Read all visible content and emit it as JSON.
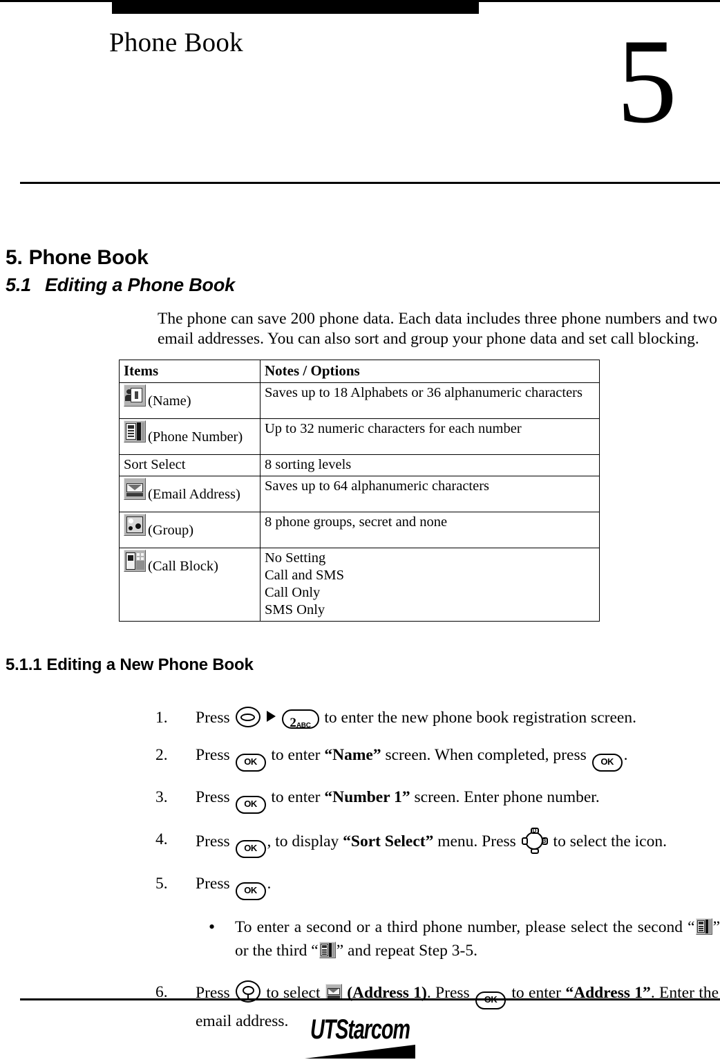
{
  "header": {
    "running_title": "Phone Book",
    "chapter_number": "5"
  },
  "headings": {
    "h1_number": "5.",
    "h1_title": "Phone Book",
    "h2_number": "5.1",
    "h2_title": "Editing a Phone Book",
    "h3_number": "5.1.1",
    "h3_title": "Editing a New Phone Book"
  },
  "intro_paragraph": "The phone can save 200 phone data. Each data includes three phone numbers and two email addresses. You can also sort and group your phone data and set call blocking.",
  "table": {
    "columns": [
      "Items",
      "Notes / Options"
    ],
    "rows": [
      {
        "icon": "name-icon",
        "label": "(Name)",
        "options": [
          "Saves up to 18 Alphabets or 36 alphanumeric characters"
        ]
      },
      {
        "icon": "phone-number-icon",
        "label": "(Phone Number)",
        "options": [
          "Up to 32 numeric characters for each number"
        ]
      },
      {
        "icon": "",
        "label": "Sort Select",
        "options": [
          "8 sorting levels"
        ]
      },
      {
        "icon": "email-address-icon",
        "label": "(Email Address)",
        "options": [
          "Saves up to 64 alphanumeric characters"
        ]
      },
      {
        "icon": "group-icon",
        "label": "(Group)",
        "options": [
          "8 phone groups, secret and none"
        ]
      },
      {
        "icon": "call-block-icon",
        "label": "(Call Block)",
        "options": [
          "No Setting",
          "Call and SMS",
          "Call Only",
          "SMS Only"
        ]
      }
    ]
  },
  "steps": [
    {
      "number": "1.",
      "parts": [
        {
          "t": "text",
          "v": "Press "
        },
        {
          "t": "key",
          "v": "soft-key"
        },
        {
          "t": "arrow",
          "v": "right-arrow-icon"
        },
        {
          "t": "key",
          "v": "2abc-key"
        },
        {
          "t": "text",
          "v": " to enter the new phone book registration screen."
        }
      ]
    },
    {
      "number": "2.",
      "parts": [
        {
          "t": "text",
          "v": "Press "
        },
        {
          "t": "key",
          "v": "ok-key"
        },
        {
          "t": "text",
          "v": " to enter "
        },
        {
          "t": "bold",
          "v": "“Name”"
        },
        {
          "t": "text",
          "v": " screen. When completed, press "
        },
        {
          "t": "key",
          "v": "ok-key"
        },
        {
          "t": "text",
          "v": "."
        }
      ]
    },
    {
      "number": "3.",
      "parts": [
        {
          "t": "text",
          "v": "Press "
        },
        {
          "t": "key",
          "v": "ok-key"
        },
        {
          "t": "text",
          "v": " to enter "
        },
        {
          "t": "bold",
          "v": "“Number 1”"
        },
        {
          "t": "text",
          "v": " screen. Enter phone number."
        }
      ]
    },
    {
      "number": "4.",
      "parts": [
        {
          "t": "text",
          "v": "Press "
        },
        {
          "t": "key",
          "v": "ok-key"
        },
        {
          "t": "text",
          "v": ", to display "
        },
        {
          "t": "bold",
          "v": "“Sort Select”"
        },
        {
          "t": "text",
          "v": " menu. Press "
        },
        {
          "t": "key",
          "v": "nav-key"
        },
        {
          "t": "text",
          "v": " to select the icon."
        }
      ]
    },
    {
      "number": "5.",
      "parts": [
        {
          "t": "text",
          "v": "Press "
        },
        {
          "t": "key",
          "v": "ok-key"
        },
        {
          "t": "text",
          "v": "."
        }
      ]
    },
    {
      "number": "6.",
      "parts": [
        {
          "t": "text",
          "v": "Press "
        },
        {
          "t": "key",
          "v": "select-key"
        },
        {
          "t": "text",
          "v": " to select "
        },
        {
          "t": "icon",
          "v": "email-address-icon"
        },
        {
          "t": "bold",
          "v": " (Address 1)"
        },
        {
          "t": "text",
          "v": ". Press "
        },
        {
          "t": "key",
          "v": "ok-key"
        },
        {
          "t": "text",
          "v": " to enter "
        },
        {
          "t": "bold",
          "v": "“Address 1”"
        },
        {
          "t": "text",
          "v": ". Enter the email address."
        }
      ]
    }
  ],
  "bullet": {
    "marker": "•",
    "parts": [
      {
        "t": "text",
        "v": "To enter a second or a third phone number, please select the second “"
      },
      {
        "t": "icon",
        "v": "phone-number-icon"
      },
      {
        "t": "text",
        "v": "” or the third “"
      },
      {
        "t": "icon",
        "v": "phone-number-icon"
      },
      {
        "t": "text",
        "v": "” and repeat Step 3-5."
      }
    ]
  },
  "footer": {
    "logo_ut": "UT",
    "logo_starcom": "Starcom"
  },
  "colors": {
    "ink": "#000000",
    "page": "#ffffff",
    "icon_face": "#b4b4b4"
  }
}
